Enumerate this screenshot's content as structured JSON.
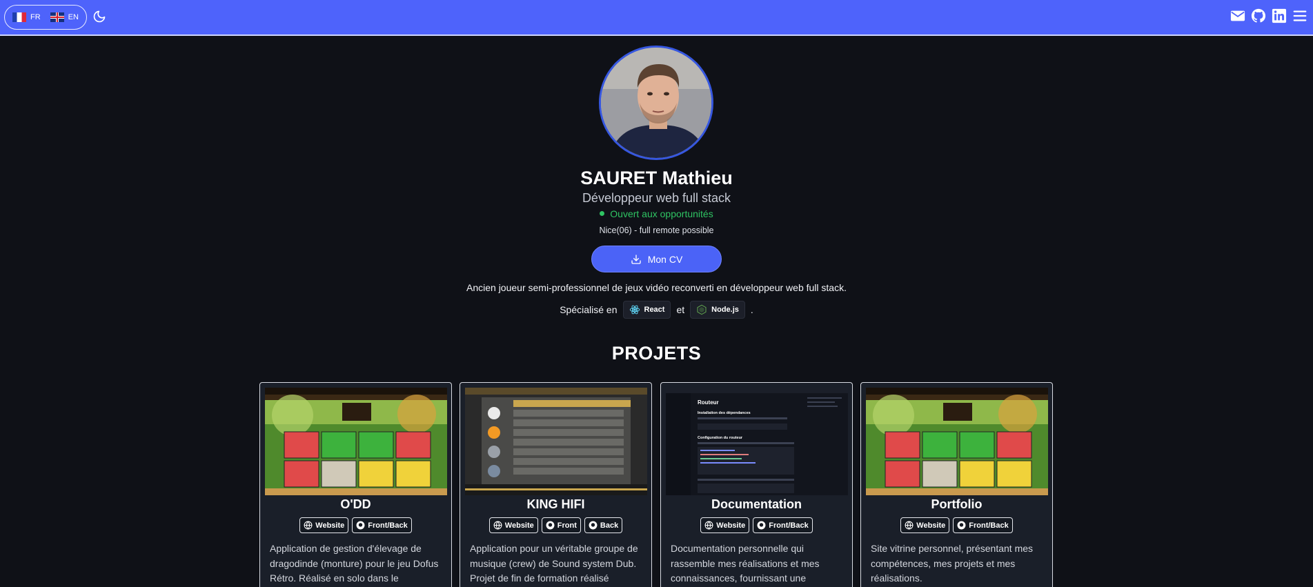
{
  "header": {
    "languages": [
      {
        "code": "FR",
        "flag": "flag-fr-icon"
      },
      {
        "code": "EN",
        "flag": "flag-uk-icon"
      }
    ],
    "theme_icon": "moon-icon",
    "social_icons": [
      "mail-icon",
      "github-icon",
      "linkedin-icon",
      "menu-icon"
    ],
    "bar_color": "#4e63fb"
  },
  "profile": {
    "name": "SAURET Mathieu",
    "role": "Développeur web full stack",
    "status": "Ouvert aux opportunités",
    "location": "Nice(06) - full remote possible",
    "cv_label": "Mon CV",
    "intro": "Ancien joueur semi-professionnel de jeux vidéo reconverti en développeur web full stack.",
    "specialized_prefix": "Spécialisé en",
    "specialized_and": "et",
    "specialized_suffix": ".",
    "tech": [
      {
        "label": "React",
        "icon": "react-icon"
      },
      {
        "label": "Node.js",
        "icon": "nodejs-icon"
      }
    ]
  },
  "projects_title": "PROJETS",
  "projects": [
    {
      "title": "O'DD",
      "links": [
        {
          "label": "Website",
          "icon": "globe-icon"
        },
        {
          "label": "Front/Back",
          "icon": "github-icon"
        }
      ],
      "description": "Application de gestion d'élevage de dragodinde (monture) pour le jeu Dofus Rétro. Réalisé en solo dans le"
    },
    {
      "title": "KING HIFI",
      "links": [
        {
          "label": "Website",
          "icon": "globe-icon"
        },
        {
          "label": "Front",
          "icon": "github-icon"
        },
        {
          "label": "Back",
          "icon": "github-icon"
        }
      ],
      "description": "Application pour un véritable groupe de musique (crew) de Sound system Dub. Projet de fin de formation réalisé"
    },
    {
      "title": "Documentation",
      "links": [
        {
          "label": "Website",
          "icon": "globe-icon"
        },
        {
          "label": "Front/Back",
          "icon": "github-icon"
        }
      ],
      "description": "Documentation personnelle qui rassemble mes réalisations et mes connaissances, fournissant une",
      "thumb_heading": "Routeur",
      "thumb_sub1": "Installation des dépendances",
      "thumb_sub2": "Configuration du routeur"
    },
    {
      "title": "Portfolio",
      "links": [
        {
          "label": "Website",
          "icon": "globe-icon"
        },
        {
          "label": "Front/Back",
          "icon": "github-icon"
        }
      ],
      "description": "Site vitrine personnel, présentant mes compétences, mes projets et mes réalisations."
    }
  ],
  "colors": {
    "accent": "#4b63f7",
    "status_green": "#2fc463",
    "background": "#0f1117",
    "card": "#1a1f29"
  }
}
